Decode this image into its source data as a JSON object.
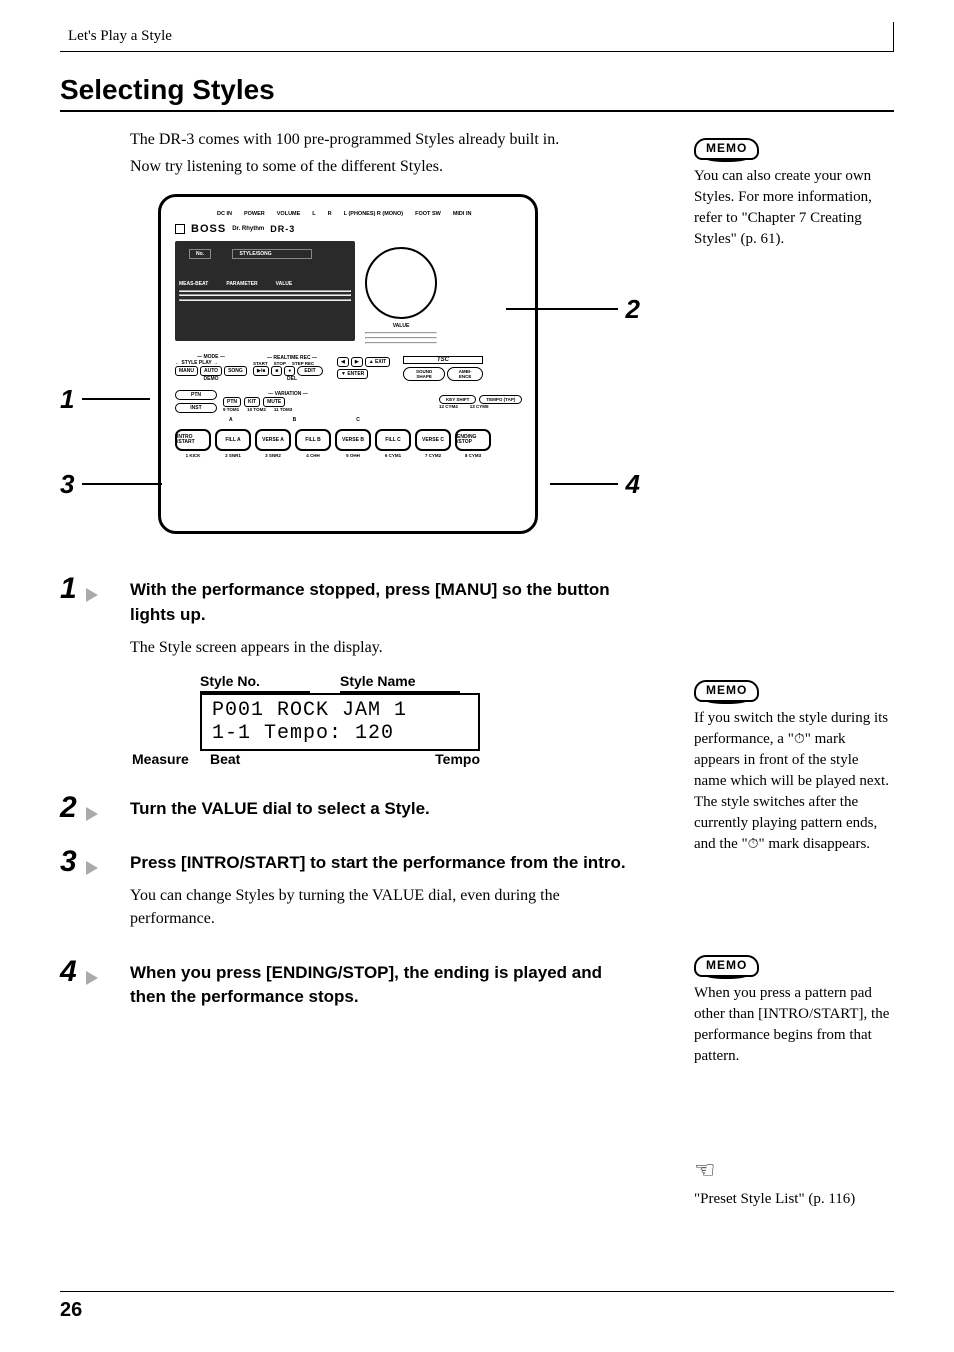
{
  "header": {
    "chapter": "Let's Play a Style"
  },
  "title": "Selecting Styles",
  "intro": {
    "p1": "The DR-3 comes with 100 pre-programmed Styles already built in.",
    "p2": "Now try listening to some of the different Styles."
  },
  "memo1": {
    "label": "MEMO",
    "text": "You can also create your own Styles. For more information, refer to \"Chapter 7 Creating Styles\" (p. 61)."
  },
  "device": {
    "top_labels": [
      "DC IN",
      "POWER",
      "VOLUME",
      "L",
      "R",
      "L (PHONES) R (MONO)",
      "FOOT SW",
      "MIDI IN"
    ],
    "brand": "BOSS",
    "model_sub": "Dr. Rhythm",
    "model": "DR-3",
    "screen_no_label": "No.",
    "screen_style_song": "STYLE/SONG",
    "screen_row_labels": [
      "MEAS-BEAT",
      "PARAMETER",
      "VALUE"
    ],
    "dial_label": "VALUE",
    "mode_label": "MODE",
    "style_play": "STYLE PLAY",
    "mode_buttons": [
      "MANU",
      "AUTO",
      "SONG"
    ],
    "demo": "DEMO",
    "realtime_label": "REALTIME REC",
    "realtime_sub": [
      "START",
      "STOP",
      "STEP REC"
    ],
    "transport": [
      "▶/■",
      "■",
      "●"
    ],
    "edit": "EDIT",
    "del": "DEL",
    "arrows": [
      "◀",
      "▶",
      "▲ EXIT",
      "▼ ENTER"
    ],
    "tsc": "TSC",
    "sound_shape": "SOUND SHAPE",
    "ambience": "AMBI-ENCE",
    "left_ovals": [
      "PTN",
      "INST"
    ],
    "variation": "VARIATION",
    "var_buttons": [
      "PTN",
      "KIT",
      "MUTE"
    ],
    "var_sub": [
      "9 TOM1",
      "10 TOM2",
      "11 TOM3"
    ],
    "key_shift": "KEY SHIFT",
    "tempo_tap": "TEMPO (TAP)",
    "key_sub": [
      "12 CYM4",
      "13 CYM5"
    ],
    "section_labels": [
      "A",
      "B",
      "C"
    ],
    "pads": [
      "INTRO /START",
      "FILL A",
      "VERSE A",
      "FILL B",
      "VERSE B",
      "FILL C",
      "VERSE C",
      "ENDING /STOP"
    ],
    "pad_nums": [
      "1 KICK",
      "2 SNR1",
      "3 SNR2",
      "4 CHH",
      "5 OHH",
      "6 CYM1",
      "7 CYM2",
      "8 CYM3"
    ],
    "callouts": {
      "c1": "1",
      "c2": "2",
      "c3": "3",
      "c4": "4"
    }
  },
  "steps": {
    "s1": {
      "num": "1",
      "title": "With the performance stopped, press [MANU] so the button lights up.",
      "body": "The Style screen appears in the display."
    },
    "lcd": {
      "top_left": "Style No.",
      "top_right": "Style Name",
      "line1": "P001 ROCK JAM 1",
      "line2": "1-1 Tempo:   120",
      "bot1": "Measure",
      "bot2": "Beat",
      "bot3": "Tempo"
    },
    "s2": {
      "num": "2",
      "title": "Turn the VALUE dial to select a Style."
    },
    "s3": {
      "num": "3",
      "title": "Press [INTRO/START] to start the performance from the intro.",
      "body": "You can change Styles by turning the VALUE dial, even during the performance."
    },
    "s4": {
      "num": "4",
      "title": "When you press [ENDING/STOP], the ending is played and then the performance stops."
    }
  },
  "memo2": {
    "label": "MEMO",
    "t1": "If you switch the style during its performance, a \"",
    "t2": "\" mark appears in front of the style name which will be played next.",
    "t3": "The style switches after the currently playing pattern ends, and the \"",
    "t4": "\" mark disappears."
  },
  "memo3": {
    "label": "MEMO",
    "text": "When you press a pattern pad other than [INTRO/START], the performance begins from that pattern."
  },
  "tip": {
    "text": "\"Preset Style List\" (p. 116)"
  },
  "page": "26"
}
